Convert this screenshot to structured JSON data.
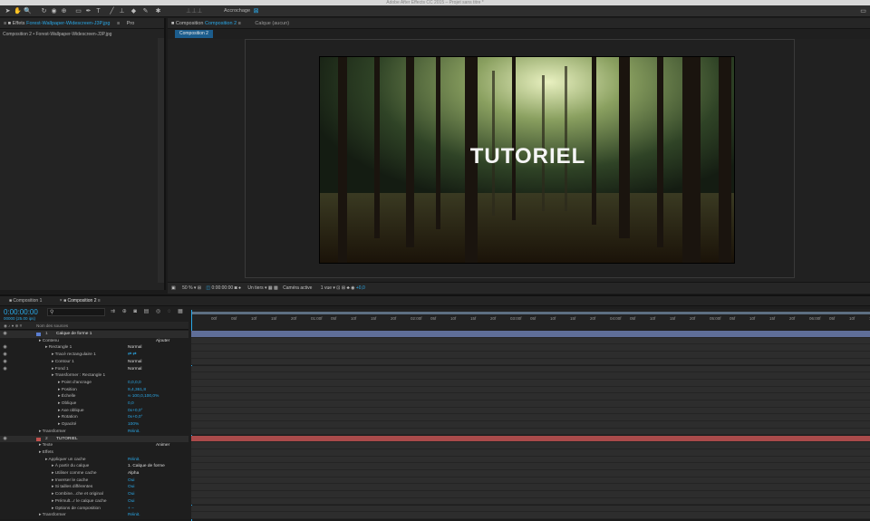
{
  "app_title": "Adobe After Effects CC 2015 – Projet sans titre *",
  "toolbar": {
    "snap_label": "Accrochage"
  },
  "left_panel": {
    "tab": "Effets",
    "tab_file": "Forest-Wallpaper-Widescreen-J3P.jpg",
    "tab2": "Pro",
    "breadcrumb": "Composition 2 • Forest-Wallpaper-Widescreen-J3P.jpg"
  },
  "comp_panel": {
    "tab_prefix": "Composition",
    "tab_name": "Composition 2",
    "layer_tab": "Calque (aucun)",
    "subtab": "Composition 2",
    "overlay_text": "TUTORIEL"
  },
  "comp_footer": {
    "zoom": "50 %",
    "timecode": "0:00:00:00",
    "resolution": "Un tiers",
    "camera": "Caméra active",
    "views": "1 vue",
    "exposure": "+0,0"
  },
  "timeline": {
    "tabs": [
      "Composition 1",
      "Composition 2"
    ],
    "timecode": "0:00:00:00",
    "fps": "00000 (25.00 ips)",
    "col_header": "Nom des sources",
    "ruler": [
      "00f",
      "05f",
      "10f",
      "15f",
      "20f",
      "01:00f",
      "05f",
      "10f",
      "15f",
      "20f",
      "02:00f",
      "05f",
      "10f",
      "15f",
      "20f",
      "03:00f",
      "05f",
      "10f",
      "15f",
      "20f",
      "04:00f",
      "05f",
      "10f",
      "15f",
      "20f",
      "05:00f",
      "05f",
      "10f",
      "15f",
      "20f",
      "06:00f",
      "05f",
      "10f",
      "15f"
    ],
    "rows": [
      {
        "indent": 0,
        "num": "1",
        "name": "Calque de forme 1",
        "value": "",
        "layer": true,
        "color": "#5b7fd1"
      },
      {
        "indent": 1,
        "name": "Contenu",
        "value": "Ajouter"
      },
      {
        "indent": 2,
        "name": "Rectangle 1",
        "value": "Normal"
      },
      {
        "indent": 3,
        "name": "Tracé rectangulaire 1",
        "value": "⇄ ⇄"
      },
      {
        "indent": 3,
        "name": "Contour 1",
        "value": "Normal"
      },
      {
        "indent": 3,
        "name": "Fond 1",
        "value": "Normal"
      },
      {
        "indent": 3,
        "name": "Transformer : Rectangle 1",
        "value": ""
      },
      {
        "indent": 4,
        "name": "Point d'ancrage",
        "value": "0,0,0,0"
      },
      {
        "indent": 4,
        "name": "Position",
        "value": "9,4,361,8"
      },
      {
        "indent": 4,
        "name": "Échelle",
        "value": "∞ 100,0,100,0%"
      },
      {
        "indent": 4,
        "name": "Oblique",
        "value": "0,0"
      },
      {
        "indent": 4,
        "name": "Axe oblique",
        "value": "0x+0,0°"
      },
      {
        "indent": 4,
        "name": "Rotation",
        "value": "0x+0,0°"
      },
      {
        "indent": 4,
        "name": "Opacité",
        "value": "100%"
      },
      {
        "indent": 1,
        "name": "Transformer",
        "value": "Réinit."
      },
      {
        "indent": 0,
        "num": "2",
        "name": "TUTORIEL",
        "value": "",
        "layer": true,
        "color": "#c0504d"
      },
      {
        "indent": 1,
        "name": "Texte",
        "value": "Animer"
      },
      {
        "indent": 1,
        "name": "Effets",
        "value": ""
      },
      {
        "indent": 2,
        "name": "Appliquer un cache",
        "value": "Réinit."
      },
      {
        "indent": 3,
        "name": "À partir du calque",
        "value": "1. Calque de forme"
      },
      {
        "indent": 3,
        "name": "Utiliser comme cache",
        "value": "Alpha"
      },
      {
        "indent": 3,
        "name": "Inverser le cache",
        "value": "Oui"
      },
      {
        "indent": 3,
        "name": "Si tailles différentes",
        "value": "Oui"
      },
      {
        "indent": 3,
        "name": "Combine...che et original",
        "value": "Oui"
      },
      {
        "indent": 3,
        "name": "Prémult...r le calque cache",
        "value": "Oui"
      },
      {
        "indent": 3,
        "name": "Options de composition",
        "value": "+ −"
      },
      {
        "indent": 1,
        "name": "Transformer",
        "value": "Réinit."
      }
    ]
  }
}
